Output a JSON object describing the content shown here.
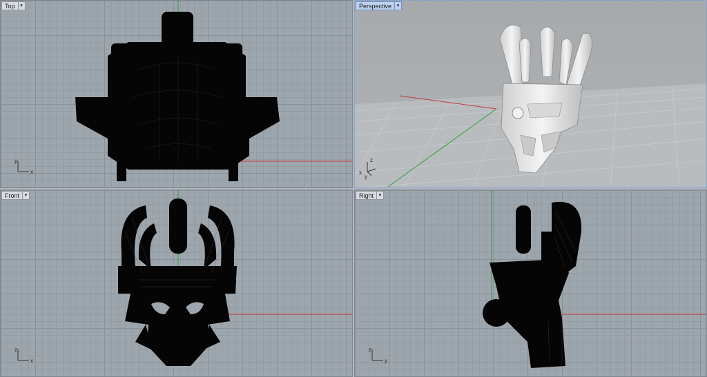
{
  "viewports": [
    {
      "id": "top",
      "label": "Top",
      "active": false,
      "axis_h": "x",
      "axis_v": "y"
    },
    {
      "id": "perspective",
      "label": "Perspective",
      "active": true,
      "axis_h": "x",
      "axis_v": "z",
      "axis_d": "y"
    },
    {
      "id": "front",
      "label": "Front",
      "active": false,
      "axis_h": "x",
      "axis_v": "z"
    },
    {
      "id": "right",
      "label": "Right",
      "active": false,
      "axis_h": "y",
      "axis_v": "z"
    }
  ],
  "dropdown_glyph": "▾",
  "colors": {
    "x_axis": "#c23b3b",
    "y_axis": "#2f9e3a",
    "wireframe": "#050505",
    "model_shaded": "#e8e8e8",
    "active_border": "#6d8fc4"
  }
}
